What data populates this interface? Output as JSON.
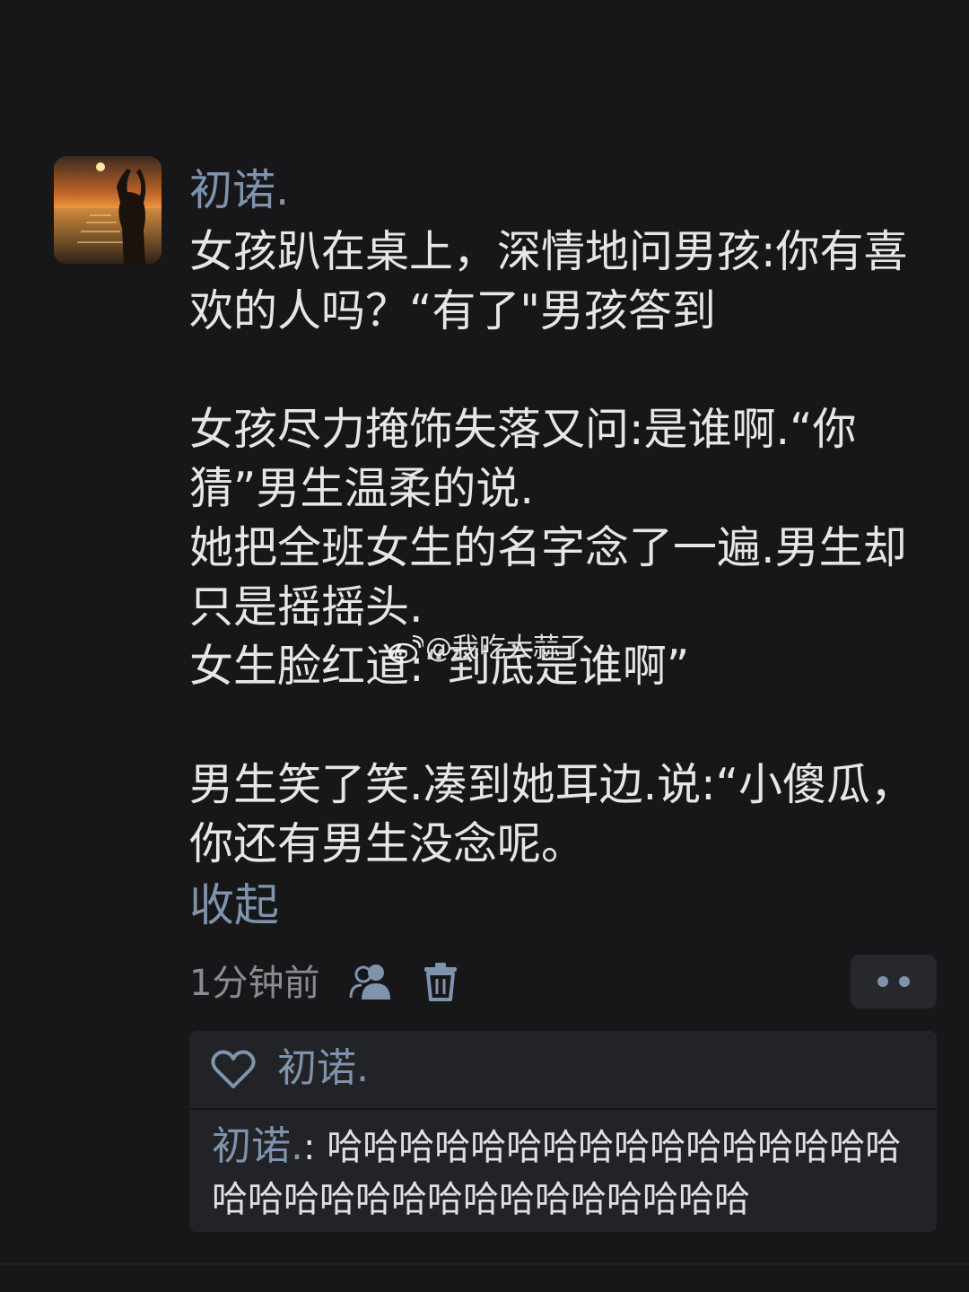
{
  "post": {
    "author": "初诺.",
    "paragraphs": [
      "女孩趴在桌上，深情地问男孩:你有喜欢的人吗？“有了\"男孩答到",
      "女孩尽力掩饰失落又问:是谁啊.“你猜”男生温柔的说.\n她把全班女生的名字念了一遍.男生却只是摇摇头.\n女生脸红道:“到底是谁啊”",
      "男生笑了笑.凑到她耳边.说:“小傻瓜，你还有男生没念呢。"
    ],
    "collapse_label": "收起",
    "timestamp": "1分钟前"
  },
  "icons": {
    "visibility": "users-icon",
    "delete": "trash-icon",
    "more": "more-dots-icon",
    "like": "heart-icon"
  },
  "comments": {
    "likes_name": "初诺.",
    "reply_author": "初诺.",
    "reply_separator": ": ",
    "reply_text": "哈哈哈哈哈哈哈哈哈哈哈哈哈哈哈哈哈哈哈哈哈哈哈哈哈哈哈哈哈哈哈"
  },
  "watermark": {
    "text": "@我吃大蒜了"
  },
  "colors": {
    "background": "#171719",
    "link_blue": "#7f93ad",
    "body_text": "#e6e6e8",
    "muted": "#8a8c92",
    "panel": "#222326"
  }
}
